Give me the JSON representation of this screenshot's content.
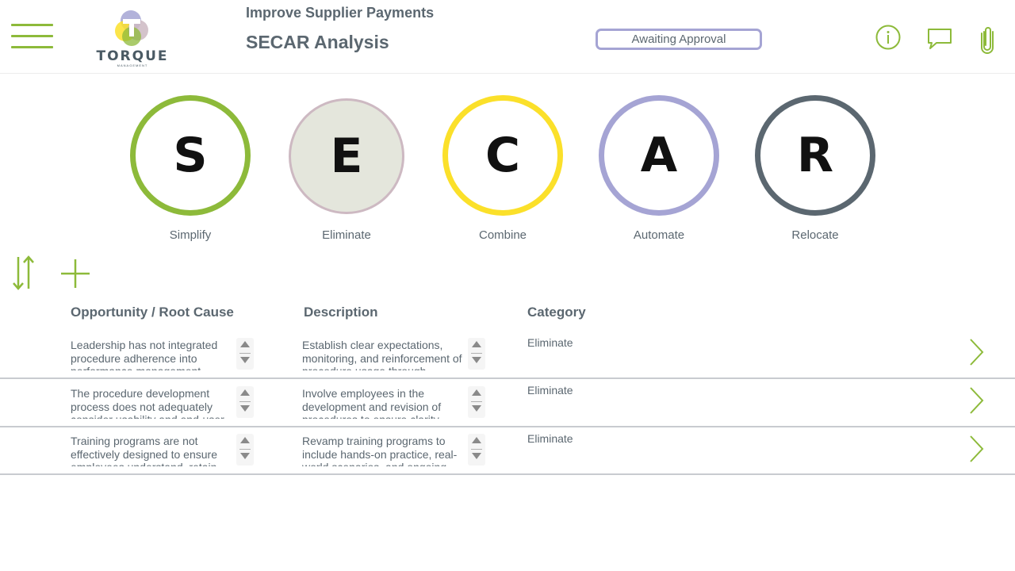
{
  "header": {
    "subtitle": "Improve Supplier Payments",
    "title": "SECAR Analysis",
    "status": "Awaiting Approval",
    "logo_text": "TORQUE",
    "logo_subtext": "MANAGEMENT",
    "icons": [
      "menu-icon",
      "info-icon",
      "comment-icon",
      "attachment-icon"
    ]
  },
  "secar": [
    {
      "letter": "S",
      "label": "Simplify",
      "border_color": "#8dba3a",
      "fill_color": "#ffffff"
    },
    {
      "letter": "E",
      "label": "Eliminate",
      "border_color": "#cdb9c2",
      "fill_color": "#e4e6dc"
    },
    {
      "letter": "C",
      "label": "Combine",
      "border_color": "#fbe02a",
      "fill_color": "#ffffff"
    },
    {
      "letter": "A",
      "label": "Automate",
      "border_color": "#a5a4d4",
      "fill_color": "#ffffff"
    },
    {
      "letter": "R",
      "label": "Relocate",
      "border_color": "#5b6770",
      "fill_color": "#ffffff"
    }
  ],
  "toolbar": {
    "icons": [
      "sort-icon",
      "add-icon"
    ]
  },
  "table": {
    "columns": [
      "Opportunity / Root Cause",
      "Description",
      "Category"
    ],
    "rows": [
      {
        "opportunity": " Leadership has not integrated procedure adherence into performance management",
        "description": "Establish clear expectations, monitoring, and reinforcement of procedure usage through",
        "category": "Eliminate"
      },
      {
        "opportunity": "The procedure development process does not adequately consider usability and end-user",
        "description": "Involve employees in the development and revision of procedures to ensure clarity",
        "category": "Eliminate"
      },
      {
        "opportunity": "Training programs are not effectively designed to ensure employees understand, retain",
        "description": "Revamp training programs to include hands-on practice, real-world scenarios, and ongoing",
        "category": "Eliminate"
      }
    ]
  },
  "colors": {
    "accent": "#8dba3a",
    "text": "#5b6770",
    "status_border": "#a5a4d4",
    "divider": "#c8cbd0"
  }
}
